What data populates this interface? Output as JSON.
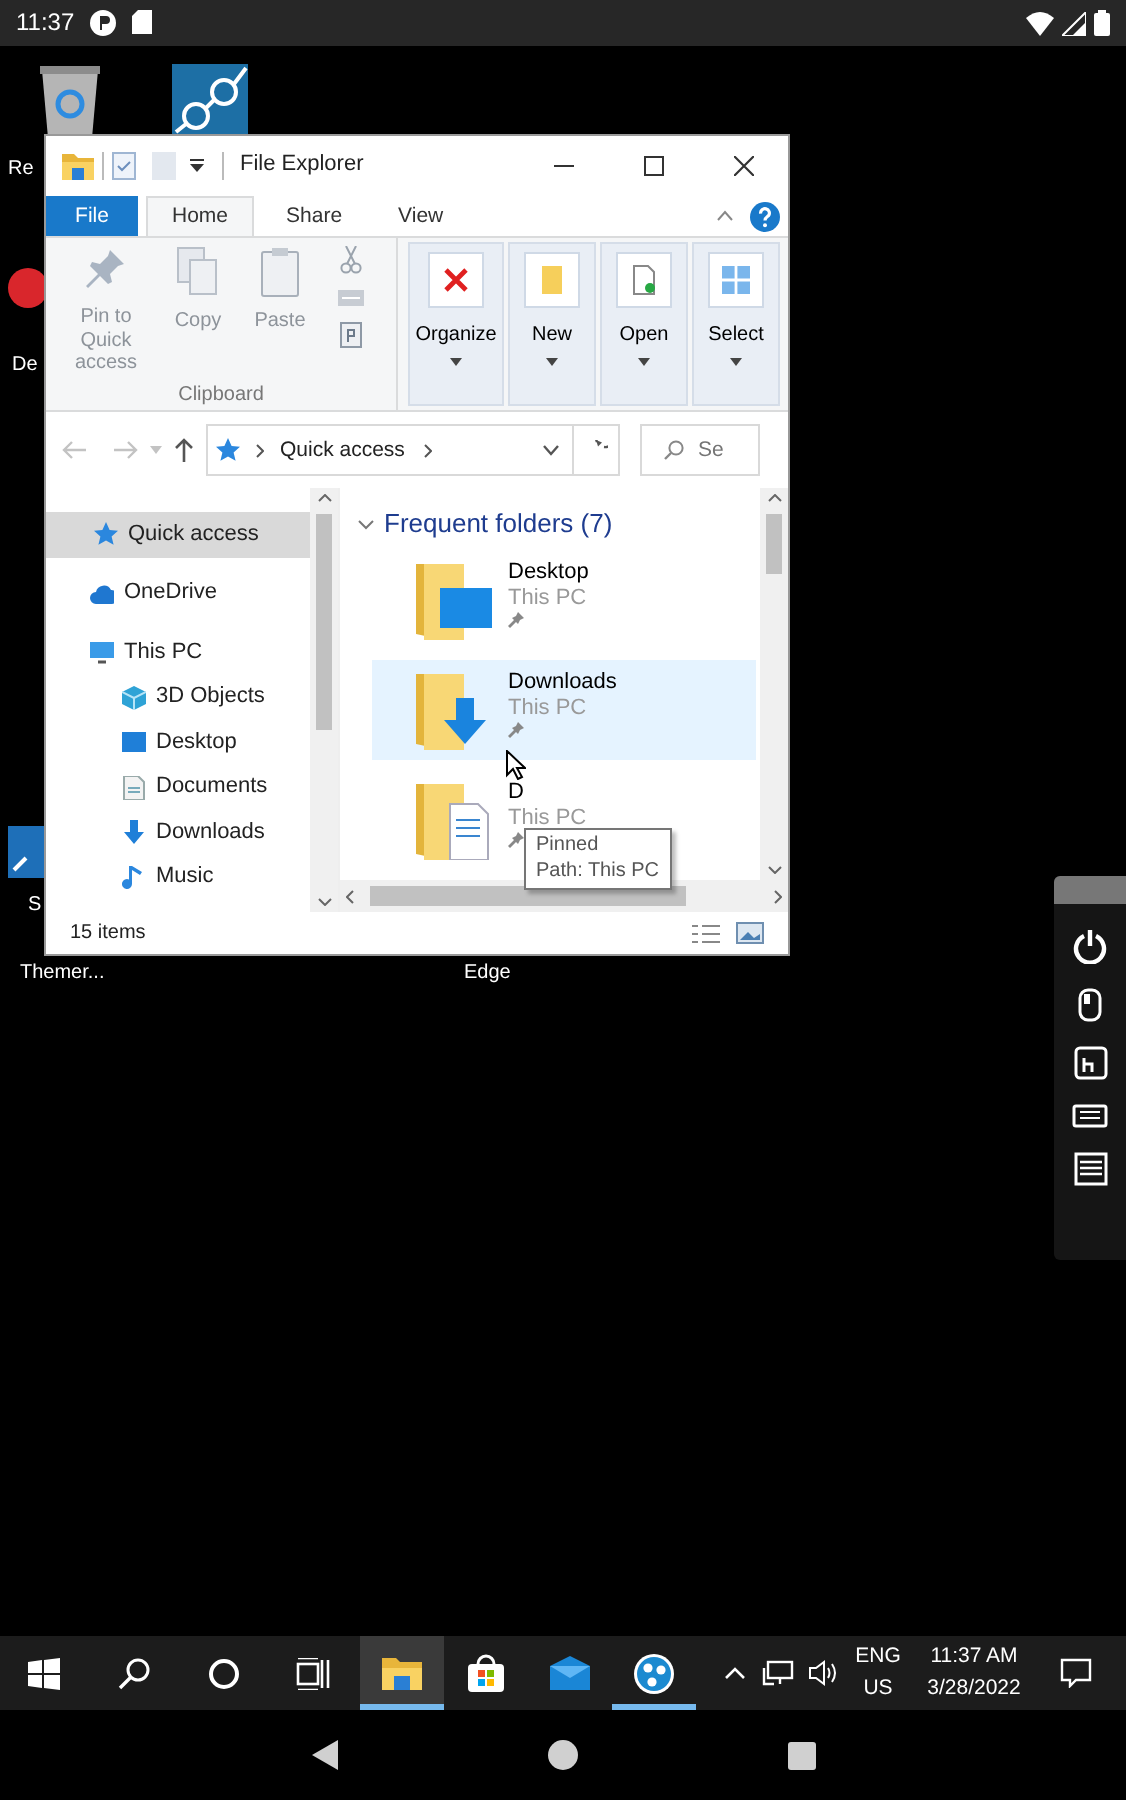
{
  "android_status": {
    "time": "11:37"
  },
  "desktop_labels": [
    {
      "text": "Re"
    },
    {
      "text": "De"
    },
    {
      "text": "S"
    },
    {
      "text": "Themer..."
    },
    {
      "text": "Edge"
    }
  ],
  "window": {
    "title": "File Explorer",
    "tabs": [
      {
        "label": "File",
        "kind": "menu",
        "selected": false
      },
      {
        "label": "Home",
        "kind": "tab",
        "selected": true
      },
      {
        "label": "Share",
        "kind": "tab",
        "selected": false
      },
      {
        "label": "View",
        "kind": "tab",
        "selected": false
      }
    ],
    "clipboard": {
      "label": "Clipboard",
      "commands": [
        {
          "label": "Pin to Quick access",
          "disabled": true
        },
        {
          "label": "Copy",
          "disabled": true
        },
        {
          "label": "Paste",
          "disabled": true
        }
      ]
    },
    "groups": [
      {
        "label": "Organize"
      },
      {
        "label": "New"
      },
      {
        "label": "Open"
      },
      {
        "label": "Select"
      }
    ],
    "address": {
      "path": "Quick access"
    },
    "search": {
      "placeholder": "Se"
    },
    "nav": [
      {
        "label": "Quick access",
        "selected": true
      },
      {
        "label": "OneDrive",
        "selected": false
      },
      {
        "label": "This PC",
        "selected": false,
        "children": [
          {
            "label": "3D Objects",
            "selected": false
          },
          {
            "label": "Desktop",
            "selected": false
          },
          {
            "label": "Documents",
            "selected": false
          },
          {
            "label": "Downloads",
            "selected": false
          },
          {
            "label": "Music",
            "selected": false
          }
        ]
      }
    ],
    "content": {
      "group": {
        "title": "Frequent folders (7)",
        "expanded": true
      },
      "items": [
        {
          "name": "Desktop",
          "location": "This PC",
          "selected": false
        },
        {
          "name": "Downloads",
          "location": "This PC",
          "selected": true
        },
        {
          "name": "D",
          "location": "This PC",
          "selected": false
        }
      ]
    },
    "tooltip": {
      "lines": [
        "Pinned",
        "Path: This PC"
      ]
    },
    "status": "15 items"
  },
  "taskbar": {
    "apps": [
      {
        "selected": true,
        "running": true
      },
      {
        "selected": false,
        "running": false
      },
      {
        "selected": false,
        "running": false
      },
      {
        "selected": false,
        "running": true
      }
    ],
    "language": [
      "ENG",
      "US"
    ],
    "time": "11:37 AM",
    "date": "3/28/2022"
  }
}
